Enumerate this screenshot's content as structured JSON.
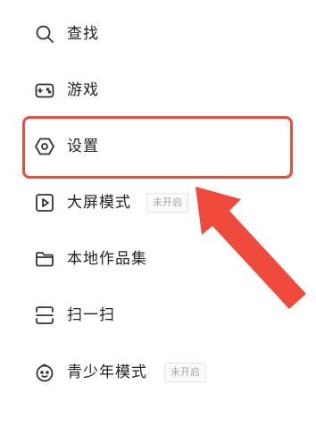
{
  "menu": {
    "items": [
      {
        "label": "查找",
        "icon": "search-icon"
      },
      {
        "label": "游戏",
        "icon": "gamepad-icon"
      },
      {
        "label": "设置",
        "icon": "settings-hexagon-icon"
      },
      {
        "label": "大屏模式",
        "icon": "play-screen-icon",
        "badge": "未开启"
      },
      {
        "label": "本地作品集",
        "icon": "folder-icon"
      },
      {
        "label": "扫一扫",
        "icon": "scan-icon"
      },
      {
        "label": "青少年模式",
        "icon": "child-face-icon",
        "badge": "未开启"
      }
    ]
  },
  "annotation": {
    "color": "#ef4a3c",
    "target": "设置"
  }
}
